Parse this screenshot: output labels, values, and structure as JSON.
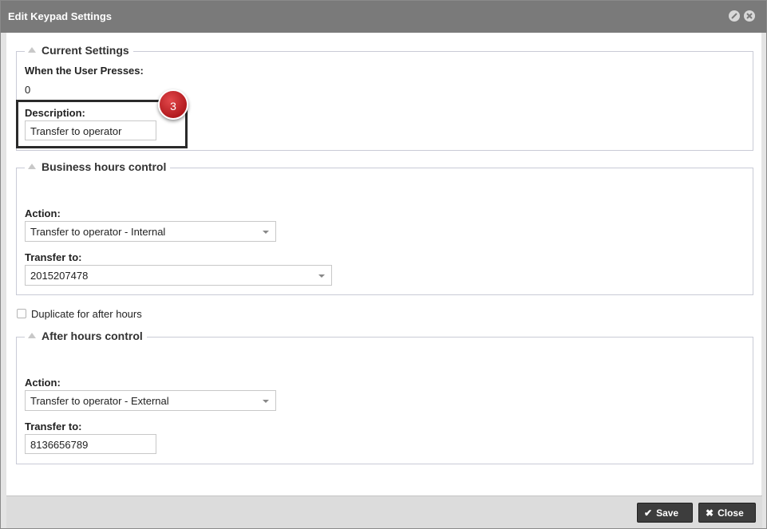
{
  "dialog": {
    "title": "Edit Keypad Settings",
    "title_icons": [
      "minimize-icon",
      "close-icon"
    ]
  },
  "current_settings": {
    "legend": "Current Settings",
    "presses_label": "When the User Presses:",
    "presses_value": "0",
    "description_label": "Description:",
    "description_value": "Transfer to operator",
    "badge": "3"
  },
  "business_hours": {
    "legend": "Business hours control",
    "action_label": "Action:",
    "action_value": "Transfer to operator - Internal",
    "transfer_label": "Transfer to:",
    "transfer_value": "2015207478"
  },
  "duplicate": {
    "label": "Duplicate for after hours",
    "checked": false
  },
  "after_hours": {
    "legend": "After hours control",
    "action_label": "Action:",
    "action_value": "Transfer to operator - External",
    "transfer_label": "Transfer to:",
    "transfer_value": "8136656789"
  },
  "footer": {
    "save_label": "Save",
    "close_label": "Close"
  },
  "colors": {
    "titlebar": "#7a7a7a",
    "badge": "#c8282c",
    "button": "#3d3d3d",
    "footer": "#dcdcdc"
  }
}
